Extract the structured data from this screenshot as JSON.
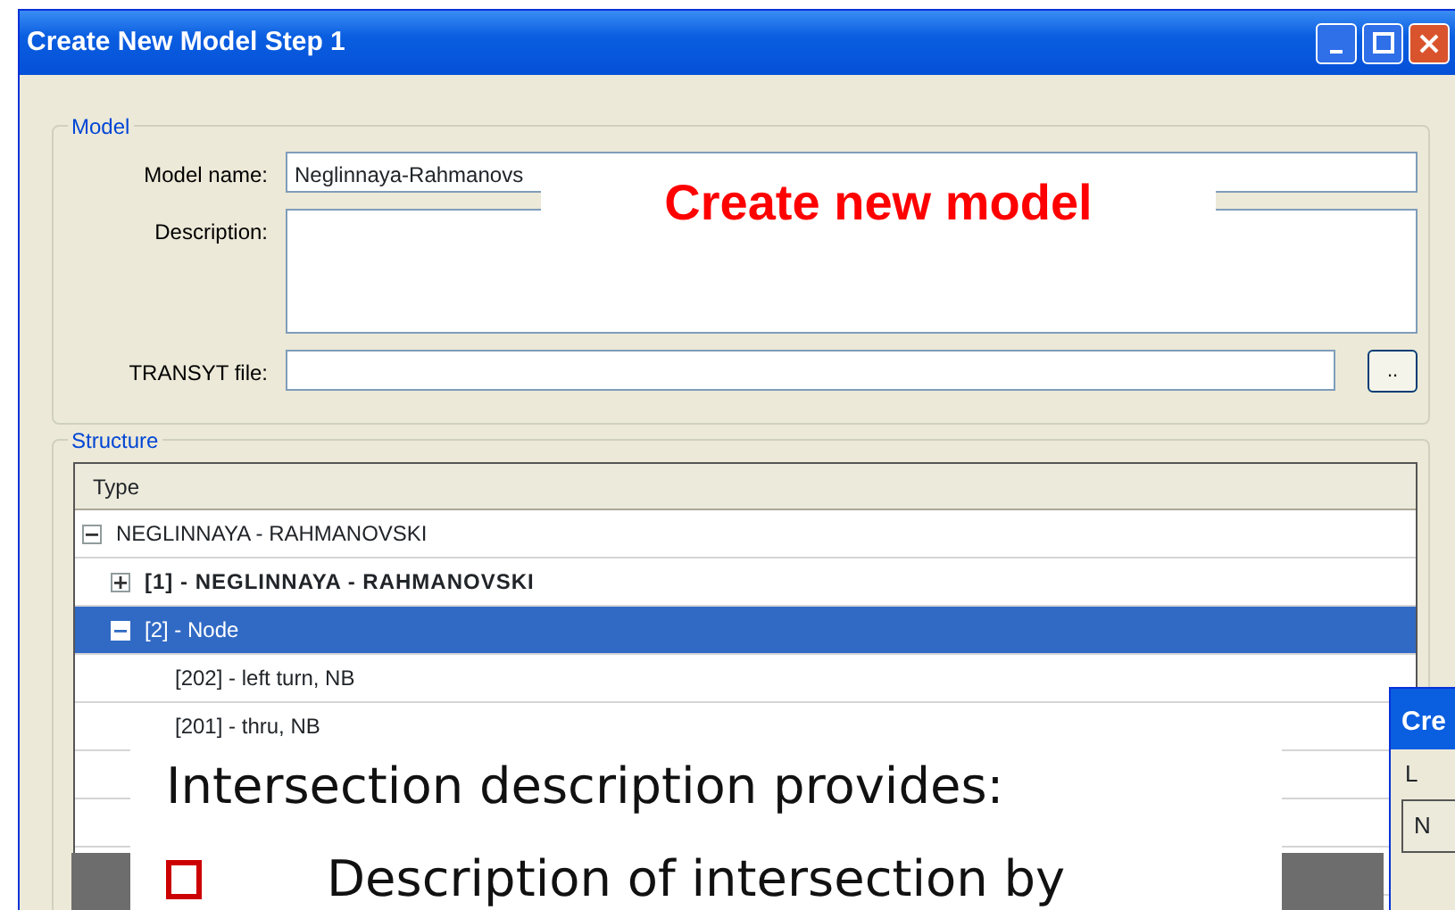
{
  "window": {
    "title": "Create New Model Step 1"
  },
  "model_group": {
    "legend": "Model",
    "fields": [
      {
        "label": "Model name:",
        "value": "Neglinnaya-Rahmanovs",
        "kind": "line"
      },
      {
        "label": "Description:",
        "kind": "area"
      },
      {
        "label": "TRANSYT file:",
        "kind": "file",
        "button": ".."
      }
    ]
  },
  "structure_group": {
    "legend": "Structure",
    "column": "Type",
    "tree": [
      {
        "label": "NEGLINNAYA - RAHMANOVSKI",
        "kind": "model",
        "expanded": true,
        "selected": false,
        "children": [
          {
            "label": "[1] - NEGLINNAYA - RAHMANOVSKI",
            "kind": "intersection",
            "expanded": false,
            "selected": false
          },
          {
            "label": "[2] - Node",
            "kind": "node",
            "expanded": true,
            "selected": true,
            "children": [
              {
                "label": "[202] - left turn, NB",
                "kind": "movement",
                "selected": false
              },
              {
                "label": "[201] - thru, NB",
                "kind": "movement",
                "selected": false
              }
            ]
          }
        ]
      }
    ]
  },
  "callout": {
    "text": "Create new model"
  },
  "slide_text": {
    "heading": "Intersection description provides:",
    "bullets": [
      "Description of intersection by"
    ]
  },
  "second_window": {
    "title": "Cre",
    "label": "L",
    "cell": "N"
  }
}
